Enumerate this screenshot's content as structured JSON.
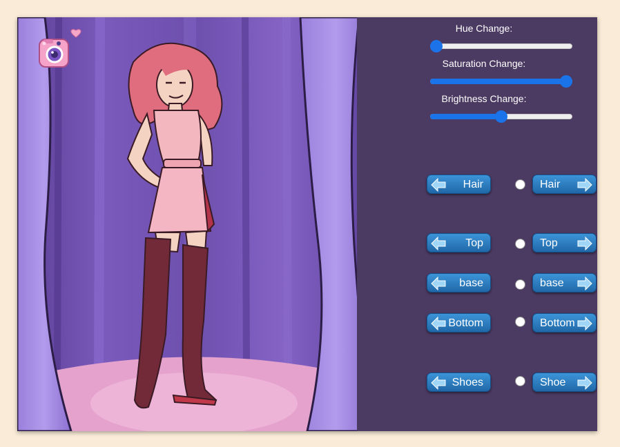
{
  "sliders": {
    "hue": {
      "label": "Hue Change:",
      "value": 0
    },
    "saturation": {
      "label": "Saturation Change:",
      "value": 100
    },
    "brightness": {
      "label": "Brightness Change:",
      "value": 50
    }
  },
  "categories": [
    {
      "id": "hair",
      "prev_label": "Hair",
      "next_label": "Hair"
    },
    {
      "id": "top",
      "prev_label": "Top",
      "next_label": "Top"
    },
    {
      "id": "base",
      "prev_label": "base",
      "next_label": "base"
    },
    {
      "id": "bottom",
      "prev_label": "Bottom",
      "next_label": "Bottom"
    },
    {
      "id": "shoes",
      "prev_label": "Shoes",
      "next_label": "Shoe"
    }
  ],
  "icons": {
    "camera": "camera-icon",
    "heart": "heart-icon",
    "arrow_left": "arrow-left-icon",
    "arrow_right": "arrow-right-icon"
  },
  "colors": {
    "background": "#f9ebd7",
    "panel": "#4b3a62",
    "curtain": "#7c5cbc",
    "button": "#2b7bc4",
    "slider_accent": "#1a73e8"
  }
}
